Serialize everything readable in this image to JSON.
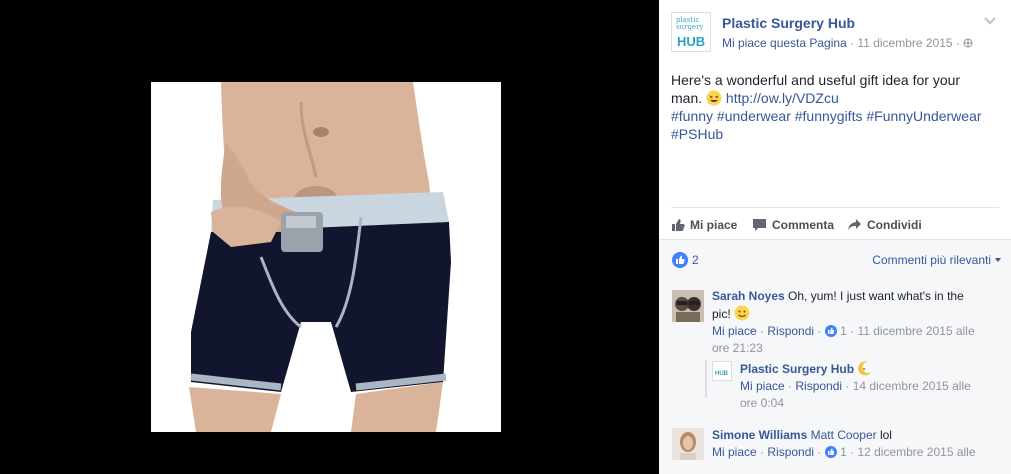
{
  "page": {
    "name": "Plastic Surgery Hub",
    "logo_text_top": "plastic",
    "logo_text_mid": "surgery",
    "logo_text_bottom": "HUB",
    "like_link": "Mi piace questa Pagina",
    "separator": " · ",
    "date": "11 dicembre 2015",
    "audience_icon": "globe-icon"
  },
  "post": {
    "text_line1": "Here's a wonderful and useful gift idea for your",
    "text_line2_pre": "man.",
    "link": "http://ow.ly/VDZcu",
    "hashtags_line1": "#funny #underwear #funnygifts #FunnyUnderwear",
    "hashtags_line2": "#PSHub"
  },
  "actions": {
    "like": "Mi piace",
    "comment": "Commenta",
    "share": "Condividi"
  },
  "social": {
    "like_count": "2",
    "sort_label": "Commenti più rilevanti"
  },
  "comments": [
    {
      "author": "Sarah Noyes",
      "text_line1": "Oh, yum! I just want what's in the",
      "text_line2": "pic!",
      "like": "Mi piace",
      "sep": " · ",
      "reply": "Rispondi",
      "likes": "1",
      "time_line1": "11 dicembre 2015 alle",
      "time_line2": "ore 21:23"
    },
    {
      "author": "Plastic Surgery Hub",
      "like": "Mi piace",
      "sep": " · ",
      "reply": "Rispondi",
      "time_line1": "14 dicembre 2015 alle",
      "time_line2": "ore 0:04"
    },
    {
      "author": "Simone Williams",
      "mention": "Matt Cooper",
      "text": "lol",
      "like": "Mi piace",
      "sep": " · ",
      "reply": "Rispondi",
      "likes": "1",
      "time_line1": "12 dicembre 2015 alle"
    }
  ],
  "colors": {
    "link": "#365899",
    "meta": "#90949c",
    "text": "#1d2129",
    "like_blue": "#4080ff"
  }
}
